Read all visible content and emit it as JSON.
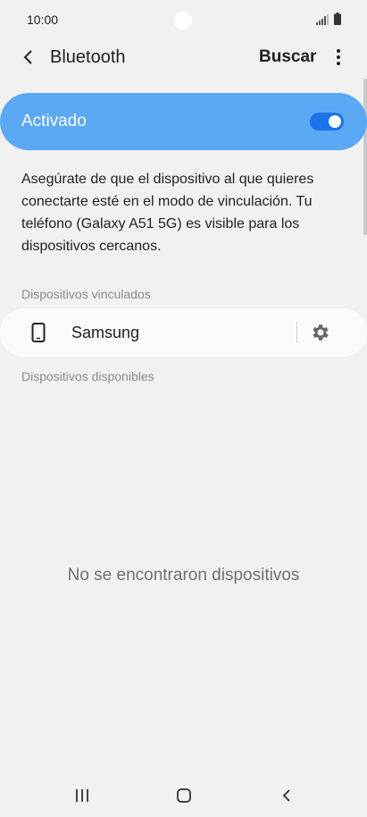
{
  "status_bar": {
    "time": "10:00",
    "icons": [
      "signal-icon",
      "battery-icon"
    ]
  },
  "header": {
    "back_icon": "back-arrow-icon",
    "title": "Bluetooth",
    "scan_label": "Buscar",
    "more_icon": "more-options-icon"
  },
  "master_switch": {
    "label": "Activado",
    "state": "on",
    "color": "#5ba8f5"
  },
  "description": "Asegúrate de que el dispositivo al que quieres conectarte esté en el modo de vinculación. Tu teléfono (Galaxy A51 5G) es visible para los dispositivos cercanos.",
  "paired_section": {
    "header": "Dispositivos vinculados",
    "devices": [
      {
        "name": "Samsung",
        "icon": "phone-icon",
        "settings_icon": "gear-icon"
      }
    ]
  },
  "available_section": {
    "header": "Dispositivos disponibles",
    "empty_message": "No se encontraron dispositivos"
  },
  "nav_bar": {
    "items": [
      "recent-apps-icon",
      "home-icon",
      "back-icon"
    ]
  }
}
